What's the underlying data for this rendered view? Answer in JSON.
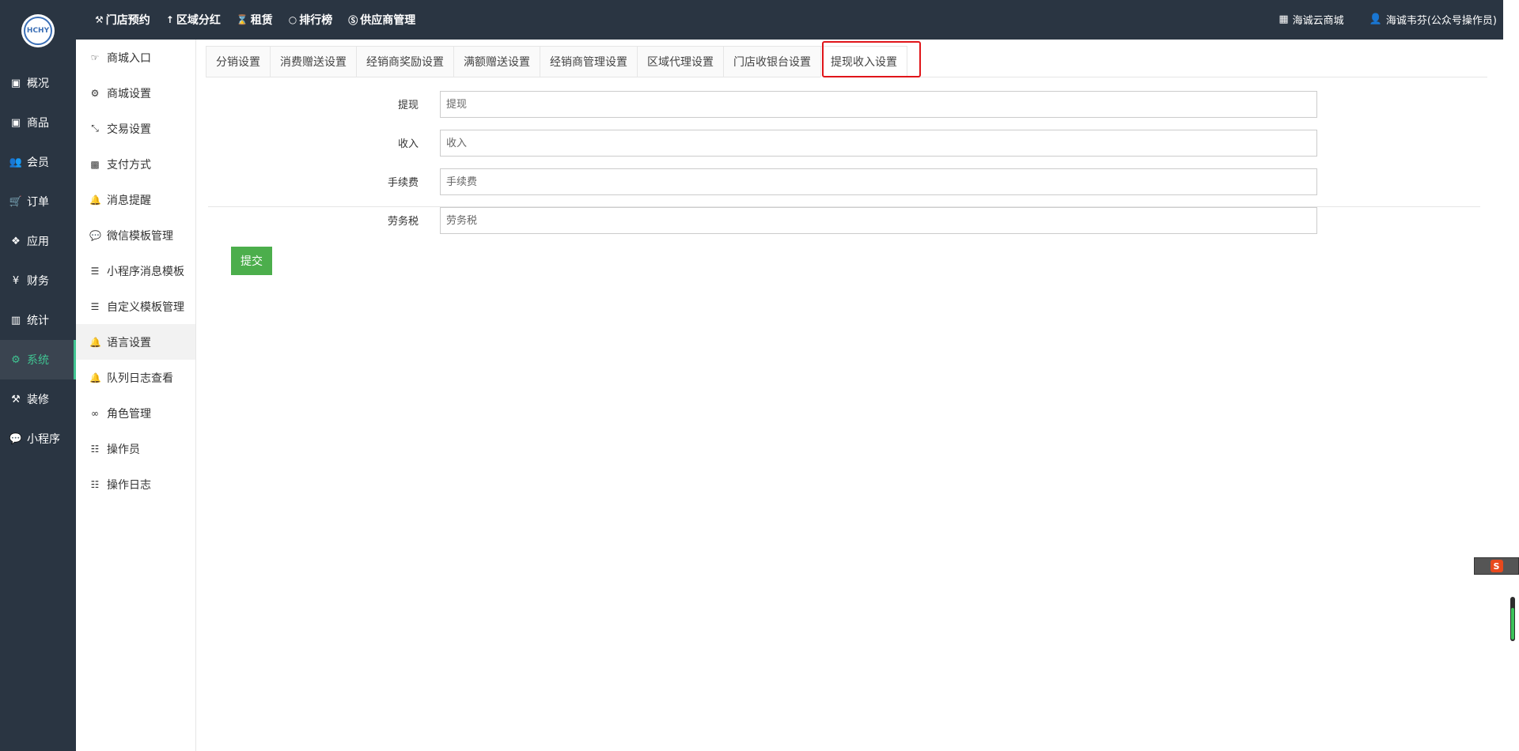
{
  "logo": {
    "text": "HCHY"
  },
  "main_nav": [
    {
      "label": "概况",
      "icon": "box-icon"
    },
    {
      "label": "商品",
      "icon": "box-icon"
    },
    {
      "label": "会员",
      "icon": "users-icon"
    },
    {
      "label": "订单",
      "icon": "cart-icon"
    },
    {
      "label": "应用",
      "icon": "cubes-icon"
    },
    {
      "label": "财务",
      "icon": "yen-icon"
    },
    {
      "label": "统计",
      "icon": "bar-chart-icon"
    },
    {
      "label": "系统",
      "icon": "cogs-icon"
    },
    {
      "label": "装修",
      "icon": "hammer-icon"
    },
    {
      "label": "小程序",
      "icon": "wechat-icon"
    }
  ],
  "top_nav": [
    {
      "label": "门店预约",
      "icon": "gavel-icon"
    },
    {
      "label": "区域分红",
      "icon": "pin-icon"
    },
    {
      "label": "租赁",
      "icon": "hourglass-icon"
    },
    {
      "label": "排行榜",
      "icon": "circle-icon"
    },
    {
      "label": "供应商管理",
      "icon": "skype-icon"
    }
  ],
  "top_right": {
    "shop": "海诚云商城",
    "user": "海诚韦芬(公众号操作员)"
  },
  "sub_nav": [
    {
      "label": "商城入口",
      "icon": "hand-icon"
    },
    {
      "label": "商城设置",
      "icon": "gear-icon"
    },
    {
      "label": "交易设置",
      "icon": "compress-icon"
    },
    {
      "label": "支付方式",
      "icon": "facebook-icon"
    },
    {
      "label": "消息提醒",
      "icon": "bell-icon"
    },
    {
      "label": "微信模板管理",
      "icon": "wechat-icon"
    },
    {
      "label": "小程序消息模板",
      "icon": "list-icon"
    },
    {
      "label": "自定义模板管理",
      "icon": "list-icon"
    },
    {
      "label": "语言设置",
      "icon": "bell-icon"
    },
    {
      "label": "队列日志查看",
      "icon": "bell-icon"
    },
    {
      "label": "角色管理",
      "icon": "mask-icon"
    },
    {
      "label": "操作员",
      "icon": "list-ul-icon"
    },
    {
      "label": "操作日志",
      "icon": "list-ul-icon"
    }
  ],
  "tabs": [
    "分销设置",
    "消费赠送设置",
    "经销商奖励设置",
    "满额赠送设置",
    "经销商管理设置",
    "区域代理设置",
    "门店收银台设置",
    "提现收入设置"
  ],
  "form": {
    "fields": [
      {
        "label": "提现",
        "placeholder": "提现"
      },
      {
        "label": "收入",
        "placeholder": "收入"
      },
      {
        "label": "手续费",
        "placeholder": "手续费"
      },
      {
        "label": "劳务税",
        "placeholder": "劳务税"
      }
    ],
    "submit": "提交"
  },
  "ime": {
    "label": "S"
  },
  "colors": {
    "sidebar": "#2a3542",
    "accent": "#40c492",
    "submit": "#4cae4c",
    "highlight": "#e0151a"
  }
}
